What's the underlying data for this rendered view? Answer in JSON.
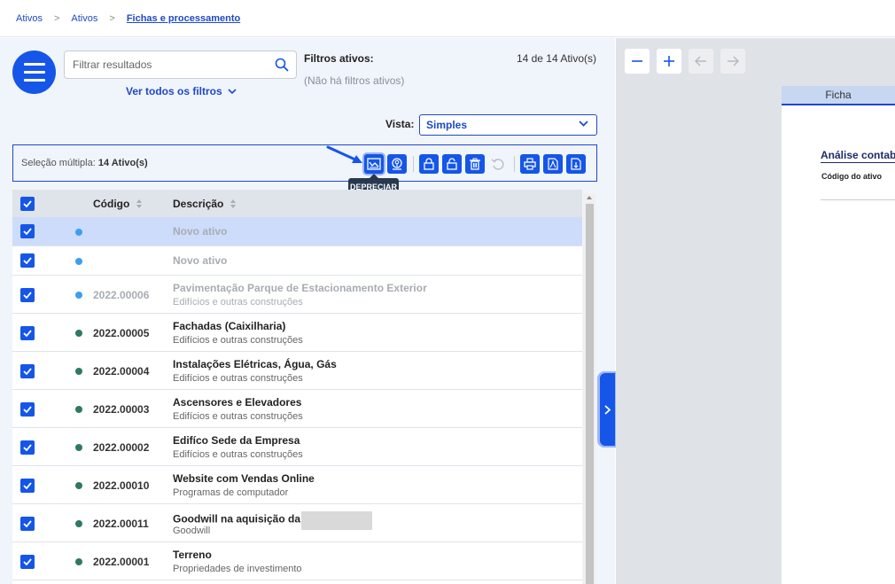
{
  "breadcrumb": {
    "items": [
      "Ativos",
      "Ativos"
    ],
    "current": "Fichas e processamento"
  },
  "search": {
    "placeholder": "Filtrar resultados",
    "value": ""
  },
  "filters": {
    "all_filters_label": "Ver todos os filtros",
    "active_title": "Filtros ativos:",
    "active_none": "(Não há filtros ativos)",
    "count": "14 de 14 Ativo(s)"
  },
  "view": {
    "label": "Vista:",
    "selected": "Simples"
  },
  "multiselect": {
    "prefix": "Seleção múltipla:",
    "count": "14 Ativo(s)",
    "tooltip": "DEPRECIAR",
    "toolbar_icons": [
      "depreciate-icon",
      "asset-tag-icon",
      "lock-icon",
      "unlock-icon",
      "trash-icon",
      "undo-icon",
      "print-icon",
      "pdf-icon",
      "export-file-icon"
    ]
  },
  "table": {
    "headers": {
      "code": "Código",
      "description": "Descrição"
    },
    "rows": [
      {
        "code": "",
        "description": "Novo ativo",
        "category": "",
        "status": "new",
        "muted": true,
        "selected": true
      },
      {
        "code": "",
        "description": "Novo ativo",
        "category": "",
        "status": "new",
        "muted": true,
        "selected": false
      },
      {
        "code": "2022.00006",
        "description": "Pavimentação Parque de Estacionamento Exterior",
        "category": "Edifícios e outras construções",
        "status": "new",
        "muted": true,
        "selected": false
      },
      {
        "code": "2022.00005",
        "description": "Fachadas (Caixilharia)",
        "category": "Edifícios e outras construções",
        "status": "active",
        "muted": false,
        "selected": false
      },
      {
        "code": "2022.00004",
        "description": "Instalações Elétricas, Água, Gás",
        "category": "Edifícios e outras construções",
        "status": "active",
        "muted": false,
        "selected": false
      },
      {
        "code": "2022.00003",
        "description": "Ascensores e Elevadores",
        "category": "Edifícios e outras construções",
        "status": "active",
        "muted": false,
        "selected": false
      },
      {
        "code": "2022.00002",
        "description": "Edifíco Sede da Empresa",
        "category": "Edifícios e outras construções",
        "status": "active",
        "muted": false,
        "selected": false
      },
      {
        "code": "2022.00010",
        "description": "Website com Vendas Online",
        "category": "Programas de computador",
        "status": "active",
        "muted": false,
        "selected": false
      },
      {
        "code": "2022.00011",
        "description": "Goodwill na aquisição da",
        "category": "Goodwill",
        "status": "active",
        "muted": false,
        "selected": false,
        "redacted": true
      },
      {
        "code": "2022.00001",
        "description": "Terreno",
        "category": "Propriedades de investimento",
        "status": "active",
        "muted": false,
        "selected": false
      }
    ]
  },
  "colors": {
    "accent": "#1556e8",
    "link": "#1f49c7",
    "status_new": "#3b9ff0",
    "status_active": "#2f7a5c"
  },
  "preview": {
    "zoom_out": "−",
    "zoom_in": "+",
    "tab": "Ficha",
    "doc_title": "Análise contabilística",
    "doc_field": "Código do ativo"
  }
}
